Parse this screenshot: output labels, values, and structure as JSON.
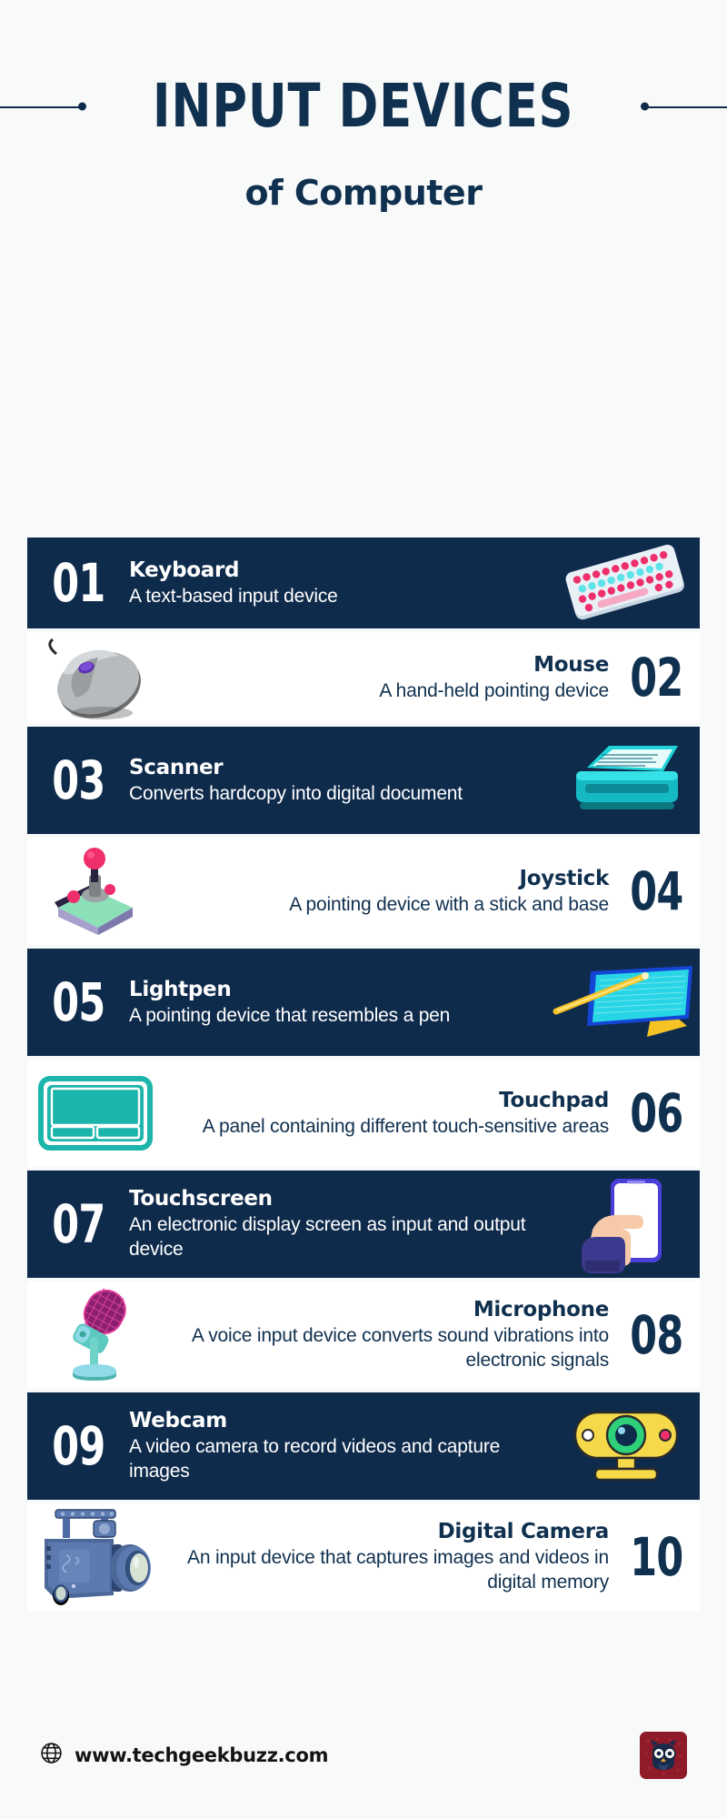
{
  "header": {
    "title": "INPUT DEVICES",
    "subtitle": "of Computer"
  },
  "rows": [
    {
      "number": "01",
      "name": "Keyboard",
      "description": "A text-based input device",
      "theme": "dark",
      "art_side": "right",
      "icon": "keyboard-illustration"
    },
    {
      "number": "02",
      "name": "Mouse",
      "description": "A hand-held pointing device",
      "theme": "light",
      "art_side": "left",
      "icon": "mouse-illustration"
    },
    {
      "number": "03",
      "name": "Scanner",
      "description": "Converts hardcopy into digital document",
      "theme": "dark",
      "art_side": "right",
      "icon": "scanner-illustration"
    },
    {
      "number": "04",
      "name": "Joystick",
      "description": "A pointing device with a stick and base",
      "theme": "light",
      "art_side": "left",
      "icon": "joystick-illustration"
    },
    {
      "number": "05",
      "name": "Lightpen",
      "description": "A pointing device that resembles a pen",
      "theme": "dark",
      "art_side": "right",
      "icon": "lightpen-illustration"
    },
    {
      "number": "06",
      "name": "Touchpad",
      "description": "A panel containing different touch-sensitive areas",
      "theme": "light",
      "art_side": "left",
      "icon": "touchpad-illustration"
    },
    {
      "number": "07",
      "name": "Touchscreen",
      "description": "An electronic display screen as input and output device",
      "theme": "dark",
      "art_side": "right",
      "icon": "touchscreen-illustration"
    },
    {
      "number": "08",
      "name": "Microphone",
      "description": "A voice input device converts sound vibrations into electronic signals",
      "theme": "light",
      "art_side": "left",
      "icon": "microphone-illustration"
    },
    {
      "number": "09",
      "name": "Webcam",
      "description": "A video camera to record videos and capture images",
      "theme": "dark",
      "art_side": "right",
      "icon": "webcam-illustration"
    },
    {
      "number": "10",
      "name": "Digital Camera",
      "description": "An input device that captures images and videos in digital memory",
      "theme": "light",
      "art_side": "left",
      "icon": "digital-camera-illustration"
    }
  ],
  "footer": {
    "globe_icon": "globe-icon",
    "url": "www.techgeekbuzz.com",
    "logo": "techgeekbuzz-owl-logo"
  },
  "colors": {
    "navy": "#0f2b4c",
    "navy_text": "#10304f",
    "page_bg": "#f8f9f9",
    "row_light_bg": "#ffffff",
    "teal": "#1bb5ab",
    "pink": "#ef2f6b",
    "yellow": "#f6c325",
    "cyan": "#28d5e6"
  }
}
